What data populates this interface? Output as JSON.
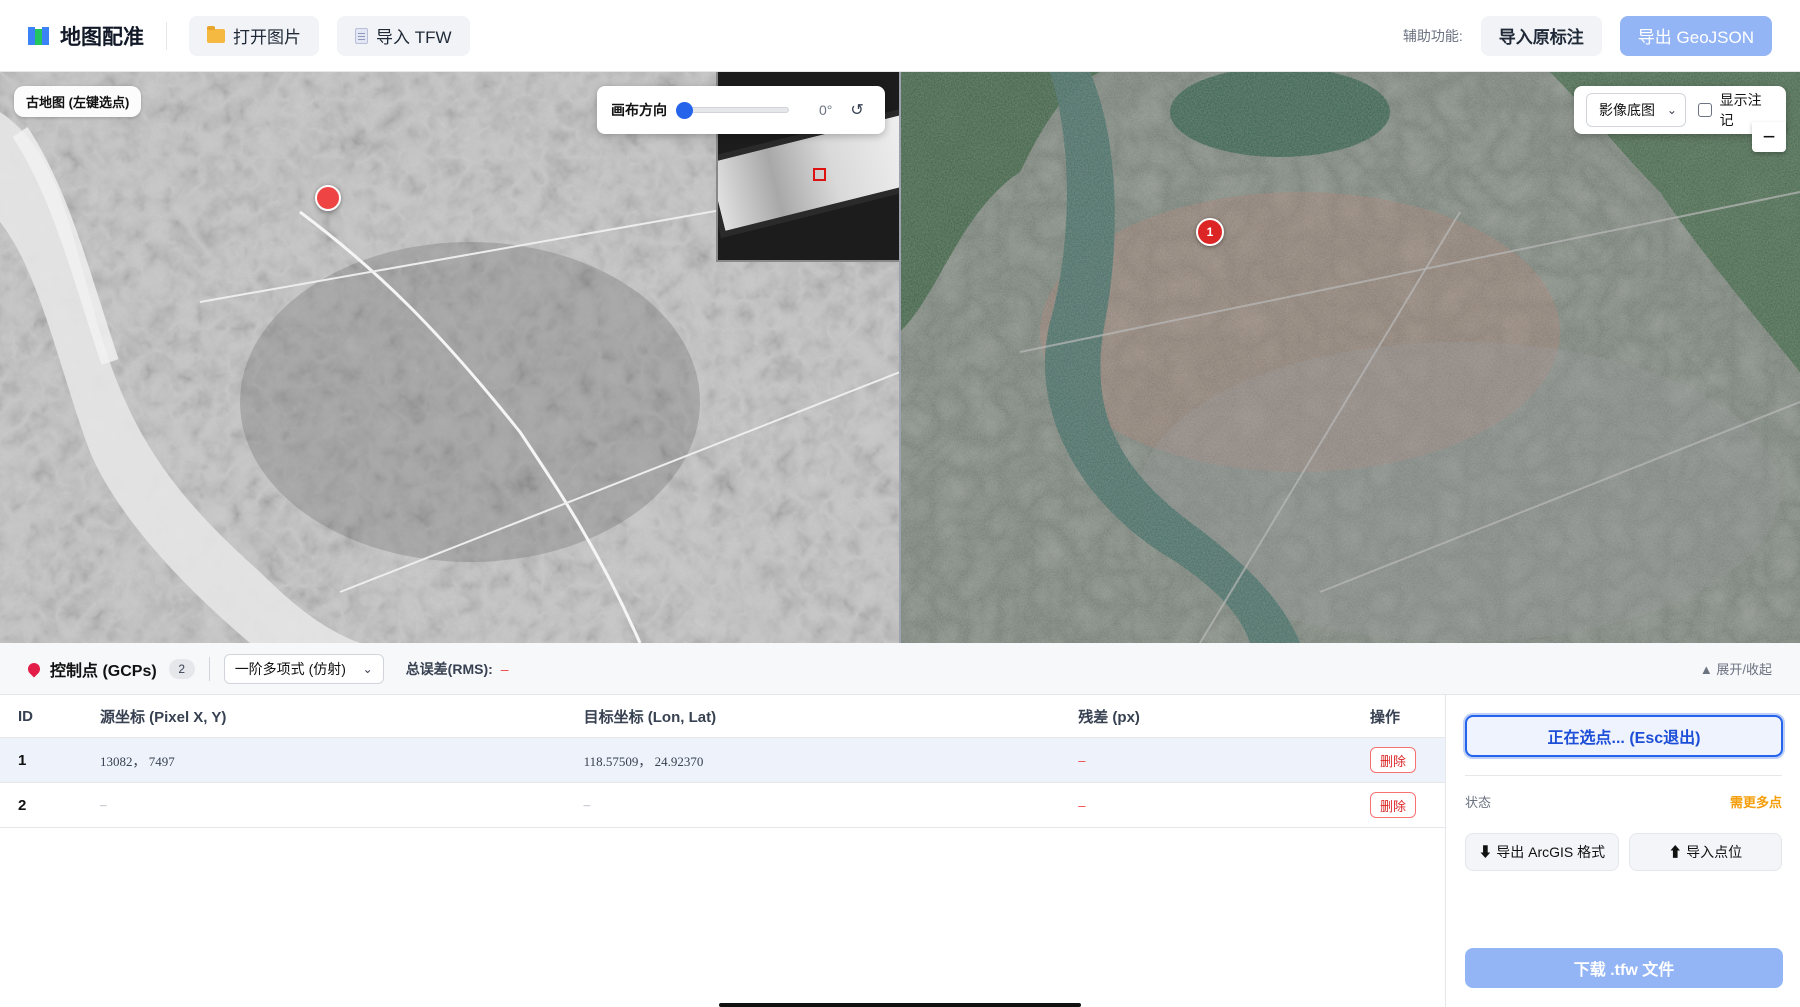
{
  "app": {
    "title": "地图配准"
  },
  "toolbar": {
    "open_image": "打开图片",
    "import_tfw": "导入 TFW",
    "aux_label": "辅助功能:",
    "import_original": "导入原标注",
    "export_geojson": "导出 GeoJSON"
  },
  "left_map": {
    "title": "古地图 (左键选点)",
    "rotate_label": "画布方向",
    "rotate_value": "0°",
    "rotate_degrees": 0
  },
  "right_map": {
    "basemap_selected": "影像底图",
    "show_labels": "显示注记",
    "zoom_out": "−",
    "marker_label": "1"
  },
  "gcp": {
    "title": "控制点 (GCPs)",
    "count": "2",
    "method": "一阶多项式 (仿射)",
    "rms_label": "总误差(RMS):",
    "rms_value": "–",
    "toggle": "▲ 展开/收起",
    "columns": {
      "id": "ID",
      "src": "源坐标 (Pixel X, Y)",
      "dst": "目标坐标 (Lon, Lat)",
      "res": "残差 (px)",
      "op": "操作"
    },
    "rows": [
      {
        "id": "1",
        "src": "13082， 7497",
        "dst": "118.57509， 24.92370",
        "res": "–",
        "op": "删除"
      },
      {
        "id": "2",
        "src": "–",
        "dst": "–",
        "res": "–",
        "op": "删除"
      }
    ]
  },
  "side": {
    "picking": "正在选点... (Esc退出)",
    "status_key": "状态",
    "status_value": "需更多点",
    "export_arcgis": "⬇ 导出 ArcGIS 格式",
    "import_points": "⬆ 导入点位",
    "download_tfw": "下载 .tfw 文件"
  },
  "colors": {
    "primary": "#2563eb",
    "primary_light": "#93b4f5",
    "danger": "#ef4444",
    "warning": "#f59e0b"
  }
}
